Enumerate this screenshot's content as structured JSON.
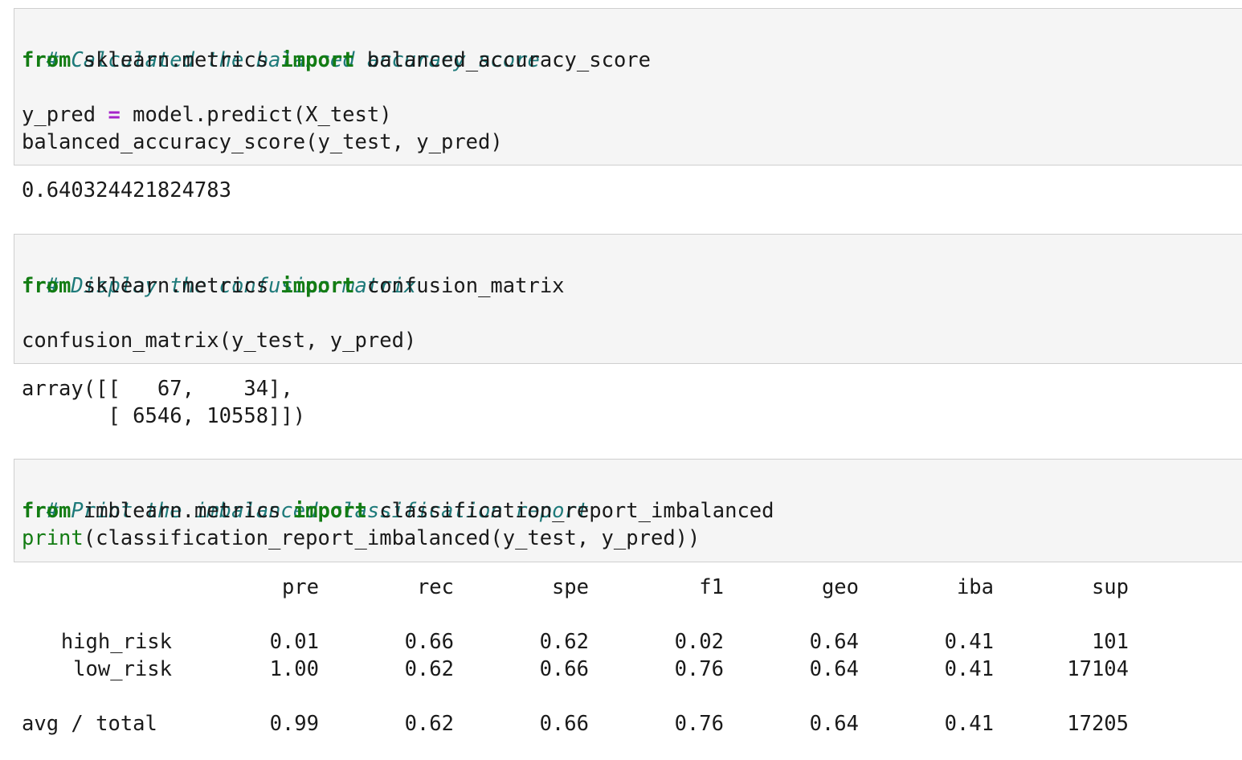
{
  "cell1": {
    "comment": "# Calculated the balanced accuracy score",
    "from_kw": "from",
    "module": " sklearn.metrics ",
    "import_kw": "import",
    "name": " balanced_accuracy_score",
    "line3_left": "y_pred ",
    "line3_op": "=",
    "line3_right": " model.predict(X_test)",
    "line4": "balanced_accuracy_score(y_test, y_pred)",
    "output": "0.640324421824783"
  },
  "cell2": {
    "comment": "# Display the confusion matrix",
    "from_kw": "from",
    "module": " sklearn.metrics ",
    "import_kw": "import",
    "name": " confusion_matrix",
    "line3": "confusion_matrix(y_test, y_pred)",
    "output_line1": "array([[   67,    34],",
    "output_line2": "       [ 6546, 10558]])"
  },
  "cell3": {
    "comment": "# Print the imbalanced classification report",
    "from_kw": "from",
    "module": " imblearn.metrics ",
    "import_kw": "import",
    "name": " classification_report_imbalanced",
    "print_kw": "print",
    "print_rest": "(classification_report_imbalanced(y_test, y_pred))"
  },
  "report": {
    "headers": [
      "pre",
      "rec",
      "spe",
      "f1",
      "geo",
      "iba",
      "sup"
    ],
    "rows": [
      {
        "label": "high_risk",
        "values": [
          "0.01",
          "0.66",
          "0.62",
          "0.02",
          "0.64",
          "0.41",
          "101"
        ]
      },
      {
        "label": "low_risk",
        "values": [
          "1.00",
          "0.62",
          "0.66",
          "0.76",
          "0.64",
          "0.41",
          "17104"
        ]
      }
    ],
    "total": {
      "label": "avg / total",
      "values": [
        "0.99",
        "0.62",
        "0.66",
        "0.76",
        "0.64",
        "0.41",
        "17205"
      ]
    }
  },
  "colors": {
    "comment": "#1e7a7a",
    "keyword": "#137c13",
    "operator": "#a523c9",
    "cell_bg": "#f5f5f5",
    "cell_border": "#cfcfcf"
  }
}
